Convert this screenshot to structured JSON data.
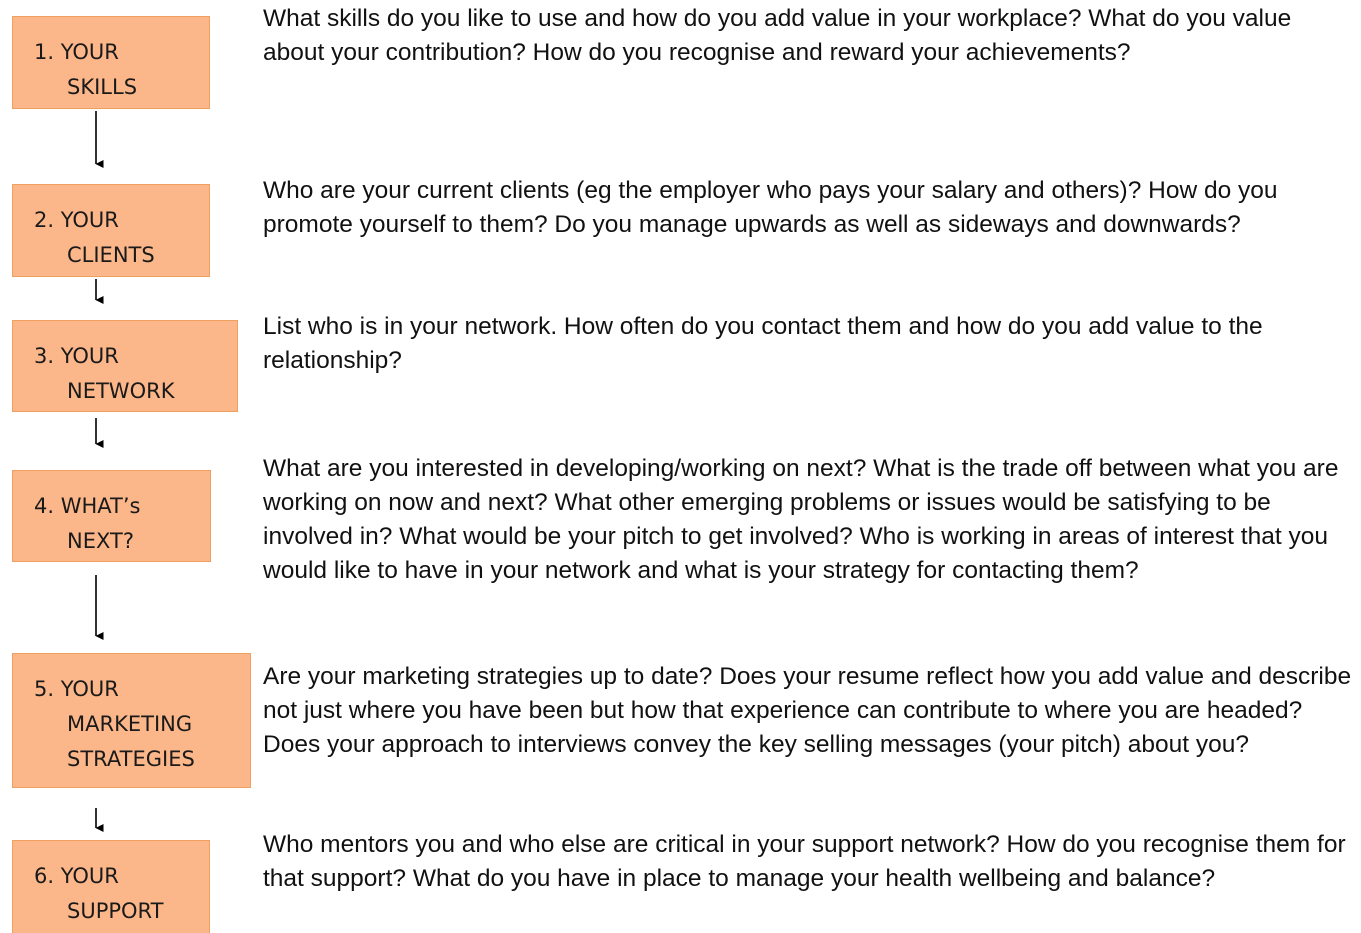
{
  "steps": [
    {
      "label_line1": "1. YOUR",
      "label_rest": "SKILLS",
      "description": "What skills do you like to use and how do you add value in your workplace? What do you value about your contribution? How do you recognise and reward your achievements?"
    },
    {
      "label_line1": "2. YOUR",
      "label_rest": "CLIENTS",
      "description": "Who are your current clients (eg the employer who pays your salary and others)? How do you promote yourself to them? Do you manage upwards as well as sideways and downwards?"
    },
    {
      "label_line1": "3. YOUR",
      "label_rest": "NETWORK",
      "description": "List who is in your network. How often do you contact them and how do you add value to the relationship?"
    },
    {
      "label_line1": "4. WHAT’s",
      "label_rest": "NEXT?",
      "description": "What are you interested in developing/working on next? What is the trade off between what you are working on now and next? What other emerging problems or issues would be satisfying to be involved in? What would be your pitch to get involved?  Who is working in areas of interest that you would like to have in your network and what is your strategy for contacting them?"
    },
    {
      "label_line1": "5. YOUR",
      "label_rest": "MARKETING\nSTRATEGIES",
      "description": "Are your marketing strategies up to date? Does your resume reflect how you add value and describe not just where you have been but how that experience can contribute to where you are headed? Does your approach to interviews convey the key selling messages (your pitch) about you?"
    },
    {
      "label_line1": "6. YOUR",
      "label_rest": "SUPPORT",
      "description": "Who mentors you and who else are critical in your support network? How do you recognise them for that support?  What do you have in place to manage your health wellbeing and balance?"
    }
  ],
  "colors": {
    "box_fill": "#fbb789",
    "box_border": "#f0a05e",
    "arrow": "#000000"
  }
}
